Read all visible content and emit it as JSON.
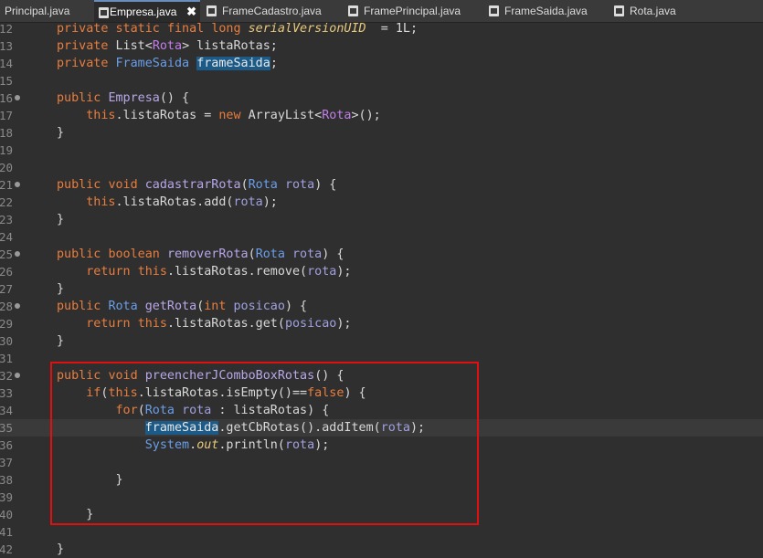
{
  "tabs": [
    {
      "label": "Principal.java",
      "active": false,
      "icon": "none"
    },
    {
      "label": "Empresa.java",
      "active": true,
      "icon": "java-file-icon",
      "close": "✖"
    },
    {
      "label": "FrameCadastro.java",
      "active": false,
      "icon": "java-file-icon"
    },
    {
      "label": "FramePrincipal.java",
      "active": false,
      "icon": "java-file-icon"
    },
    {
      "label": "FrameSaida.java",
      "active": false,
      "icon": "java-file-icon"
    },
    {
      "label": "Rota.java",
      "active": false,
      "icon": "java-file-icon"
    }
  ],
  "editor": {
    "lines": [
      {
        "num": "12",
        "fold": false,
        "tokens": [
          [
            "kw",
            "private "
          ],
          [
            "kw",
            "static "
          ],
          [
            "kw",
            "final "
          ],
          [
            "kw",
            "long "
          ],
          [
            "it",
            "serialVersionUID"
          ],
          [
            "",
            "  = 1L;"
          ]
        ]
      },
      {
        "num": "13",
        "fold": false,
        "tokens": [
          [
            "kw",
            "private "
          ],
          [
            "",
            "List<"
          ],
          [
            "gn",
            "Rota"
          ],
          [
            "",
            "> listaRotas;"
          ]
        ]
      },
      {
        "num": "14",
        "fold": false,
        "tokens": [
          [
            "kw",
            "private "
          ],
          [
            "ty",
            "FrameSaida "
          ],
          [
            "hl",
            "frameSaida"
          ],
          [
            "",
            ";"
          ]
        ]
      },
      {
        "num": "15",
        "fold": false,
        "tokens": []
      },
      {
        "num": "16",
        "fold": true,
        "tokens": [
          [
            "kw",
            "public "
          ],
          [
            "fn",
            "Empresa"
          ],
          [
            "",
            "() {"
          ]
        ]
      },
      {
        "num": "17",
        "fold": false,
        "tokens": [
          [
            "",
            "    "
          ],
          [
            "kw",
            "this"
          ],
          [
            "",
            ".listaRotas = "
          ],
          [
            "kw",
            "new "
          ],
          [
            "",
            "ArrayList<"
          ],
          [
            "gn",
            "Rota"
          ],
          [
            "",
            ">();"
          ]
        ]
      },
      {
        "num": "18",
        "fold": false,
        "tokens": [
          [
            "",
            "}"
          ]
        ]
      },
      {
        "num": "19",
        "fold": false,
        "tokens": []
      },
      {
        "num": "20",
        "fold": false,
        "tokens": []
      },
      {
        "num": "21",
        "fold": true,
        "tokens": [
          [
            "kw",
            "public "
          ],
          [
            "kw",
            "void "
          ],
          [
            "fn",
            "cadastrarRota"
          ],
          [
            "",
            "("
          ],
          [
            "ty",
            "Rota "
          ],
          [
            "var",
            "rota"
          ],
          [
            "",
            ") {"
          ]
        ]
      },
      {
        "num": "22",
        "fold": false,
        "tokens": [
          [
            "",
            "    "
          ],
          [
            "kw",
            "this"
          ],
          [
            "",
            ".listaRotas.add("
          ],
          [
            "var",
            "rota"
          ],
          [
            "",
            ");"
          ]
        ]
      },
      {
        "num": "23",
        "fold": false,
        "tokens": [
          [
            "",
            "}"
          ]
        ]
      },
      {
        "num": "24",
        "fold": false,
        "tokens": []
      },
      {
        "num": "25",
        "fold": true,
        "tokens": [
          [
            "kw",
            "public "
          ],
          [
            "kw",
            "boolean "
          ],
          [
            "fn",
            "removerRota"
          ],
          [
            "",
            "("
          ],
          [
            "ty",
            "Rota "
          ],
          [
            "var",
            "rota"
          ],
          [
            "",
            ") {"
          ]
        ]
      },
      {
        "num": "26",
        "fold": false,
        "tokens": [
          [
            "",
            "    "
          ],
          [
            "kw",
            "return "
          ],
          [
            "kw",
            "this"
          ],
          [
            "",
            ".listaRotas.remove("
          ],
          [
            "var",
            "rota"
          ],
          [
            "",
            ");"
          ]
        ]
      },
      {
        "num": "27",
        "fold": false,
        "tokens": [
          [
            "",
            "}"
          ]
        ]
      },
      {
        "num": "28",
        "fold": true,
        "tokens": [
          [
            "kw",
            "public "
          ],
          [
            "ty",
            "Rota "
          ],
          [
            "fn",
            "getRota"
          ],
          [
            "",
            "("
          ],
          [
            "kw",
            "int "
          ],
          [
            "var",
            "posicao"
          ],
          [
            "",
            ") {"
          ]
        ]
      },
      {
        "num": "29",
        "fold": false,
        "tokens": [
          [
            "",
            "    "
          ],
          [
            "kw",
            "return "
          ],
          [
            "kw",
            "this"
          ],
          [
            "",
            ".listaRotas.get("
          ],
          [
            "var",
            "posicao"
          ],
          [
            "",
            ");"
          ]
        ]
      },
      {
        "num": "30",
        "fold": false,
        "tokens": [
          [
            "",
            "}"
          ]
        ]
      },
      {
        "num": "31",
        "fold": false,
        "tokens": []
      },
      {
        "num": "32",
        "fold": true,
        "tokens": [
          [
            "kw",
            "public "
          ],
          [
            "kw",
            "void "
          ],
          [
            "fn",
            "preencherJComboBoxRotas"
          ],
          [
            "",
            "() {"
          ]
        ]
      },
      {
        "num": "33",
        "fold": false,
        "tokens": [
          [
            "",
            "    "
          ],
          [
            "kw",
            "if"
          ],
          [
            "",
            "("
          ],
          [
            "kw",
            "this"
          ],
          [
            "",
            ".listaRotas.isEmpty()=="
          ],
          [
            "kw",
            "false"
          ],
          [
            "",
            ") {"
          ]
        ]
      },
      {
        "num": "34",
        "fold": false,
        "tokens": [
          [
            "",
            "        "
          ],
          [
            "kw",
            "for"
          ],
          [
            "",
            "("
          ],
          [
            "ty",
            "Rota "
          ],
          [
            "var",
            "rota"
          ],
          [
            "",
            " : listaRotas) {"
          ]
        ]
      },
      {
        "num": "35",
        "fold": false,
        "current": true,
        "tokens": [
          [
            "",
            "            "
          ],
          [
            "hl",
            "frameSaida"
          ],
          [
            "",
            ".getCbRotas().addItem("
          ],
          [
            "var",
            "rota"
          ],
          [
            "",
            ");"
          ]
        ]
      },
      {
        "num": "36",
        "fold": false,
        "tokens": [
          [
            "",
            "            "
          ],
          [
            "ty",
            "System"
          ],
          [
            "",
            "."
          ],
          [
            "it",
            "out"
          ],
          [
            "",
            ".println("
          ],
          [
            "var",
            "rota"
          ],
          [
            "",
            ");"
          ]
        ]
      },
      {
        "num": "37",
        "fold": false,
        "tokens": []
      },
      {
        "num": "38",
        "fold": false,
        "tokens": [
          [
            "",
            "        }"
          ]
        ]
      },
      {
        "num": "39",
        "fold": false,
        "tokens": []
      },
      {
        "num": "40",
        "fold": false,
        "tokens": [
          [
            "",
            "    }"
          ]
        ]
      },
      {
        "num": "41",
        "fold": false,
        "tokens": []
      },
      {
        "num": "42",
        "fold": false,
        "tokens": [
          [
            "",
            "}"
          ]
        ]
      }
    ]
  }
}
